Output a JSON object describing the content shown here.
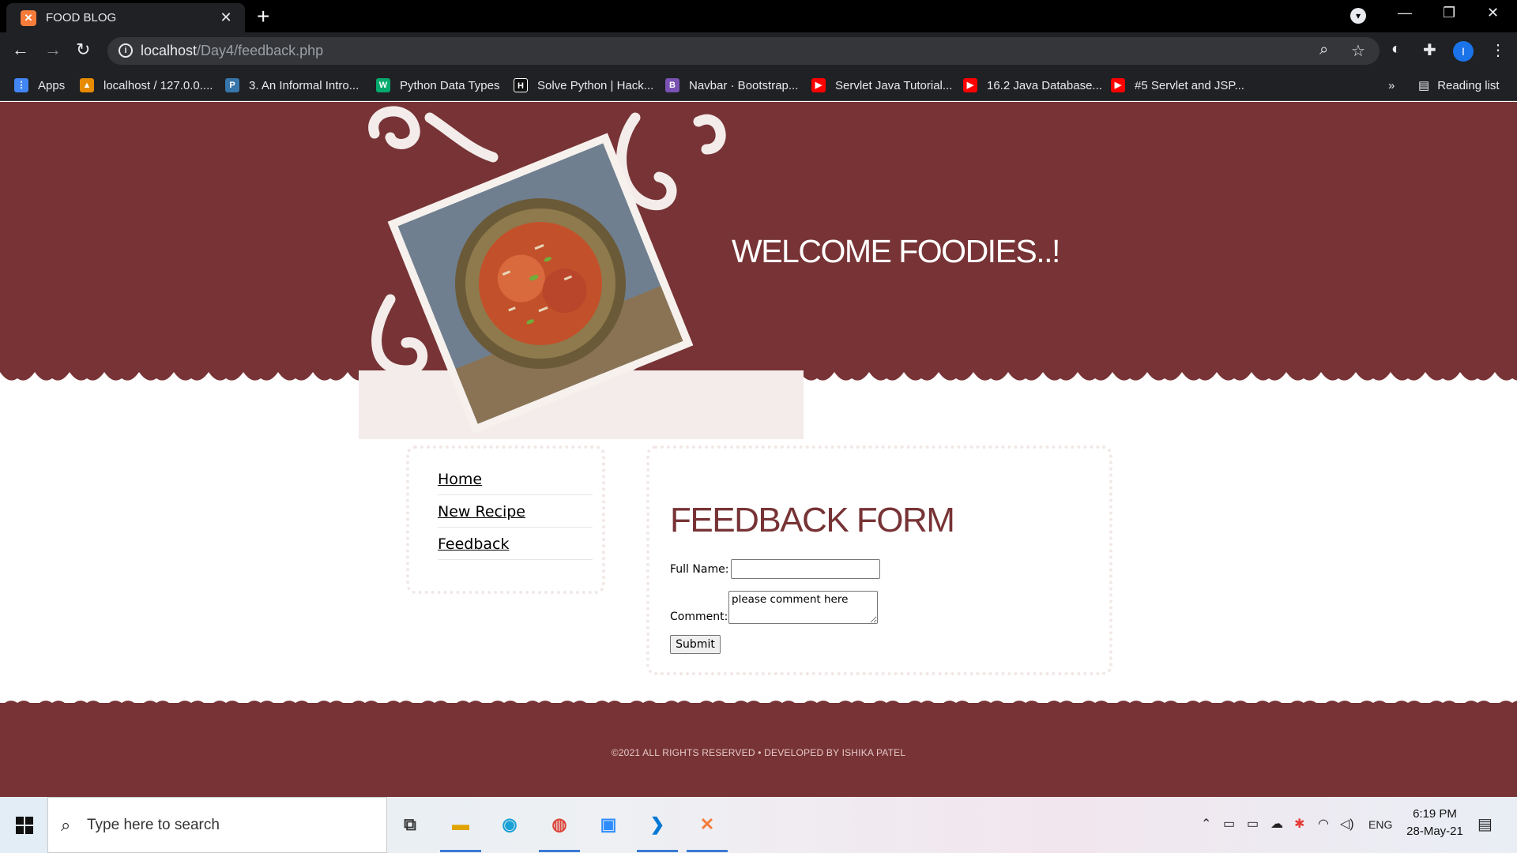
{
  "browser": {
    "tab_title": "FOOD BLOG",
    "tab_favicon": "xampp-icon",
    "url_host": "localhost",
    "url_path": "/Day4/feedback.php",
    "bookmarks": [
      {
        "label": "Apps",
        "icon": "apps-grid-icon"
      },
      {
        "label": "localhost / 127.0.0....",
        "icon": "phpmyadmin-icon"
      },
      {
        "label": "3. An Informal Intro...",
        "icon": "python-icon"
      },
      {
        "label": "Python Data Types",
        "icon": "w3schools-icon"
      },
      {
        "label": "Solve Python | Hack...",
        "icon": "hackerrank-icon"
      },
      {
        "label": "Navbar · Bootstrap...",
        "icon": "bootstrap-icon"
      },
      {
        "label": "Servlet Java Tutorial...",
        "icon": "youtube-icon"
      },
      {
        "label": "16.2 Java Database...",
        "icon": "youtube-icon"
      },
      {
        "label": "#5 Servlet and JSP...",
        "icon": "youtube-icon"
      }
    ],
    "overflow_label": "»",
    "reading_list": "Reading list",
    "profile_initial": "I"
  },
  "page": {
    "welcome": "WELCOME FOODIES..!",
    "nav": [
      "Home",
      "New Recipe",
      "Feedback"
    ],
    "form": {
      "title": "FEEDBACK FORM",
      "full_name_label": "Full Name:",
      "full_name_value": "",
      "comment_label": "Comment:",
      "comment_value": "please comment here",
      "submit_label": "Submit"
    },
    "footer": "©2021 ALL RIGHTS RESERVED  •  DEVELOPED BY ISHIKA PATEL"
  },
  "colors": {
    "brand_maroon": "#773335",
    "hero_cream": "#f3ecea"
  },
  "taskbar": {
    "search_placeholder": "Type here to search",
    "language": "ENG",
    "time": "6:19 PM",
    "date": "28-May-21"
  }
}
